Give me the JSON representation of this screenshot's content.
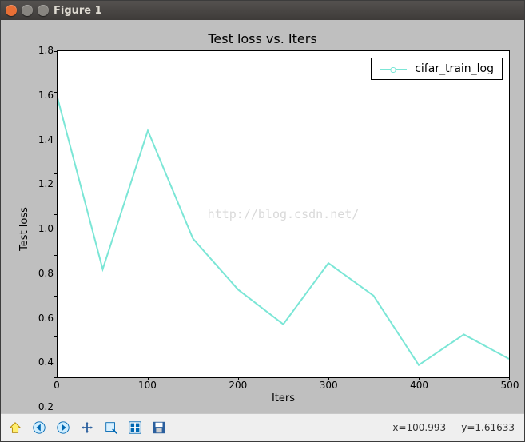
{
  "window": {
    "title": "Figure 1"
  },
  "chart_data": {
    "type": "line",
    "title": "Test loss  vs. Iters",
    "xlabel": "Iters",
    "ylabel": "Test loss",
    "xlim": [
      0,
      500
    ],
    "ylim": [
      0.2,
      1.8
    ],
    "xticks": [
      0,
      100,
      200,
      300,
      400,
      500
    ],
    "yticks": [
      0.2,
      0.4,
      0.6,
      0.8,
      1.0,
      1.2,
      1.4,
      1.6,
      1.8
    ],
    "series": [
      {
        "name": "cifar_train_log",
        "x": [
          0,
          50,
          100,
          150,
          200,
          250,
          300,
          350,
          400,
          450,
          500
        ],
        "y": [
          1.57,
          0.73,
          1.41,
          0.88,
          0.63,
          0.46,
          0.76,
          0.6,
          0.26,
          0.41,
          0.29
        ],
        "color": "#7be6d6"
      }
    ],
    "legend_position": "upper right",
    "watermark": "http://blog.csdn.net/"
  },
  "toolbar": {
    "coords": "x=100.993     y=1.61633"
  }
}
